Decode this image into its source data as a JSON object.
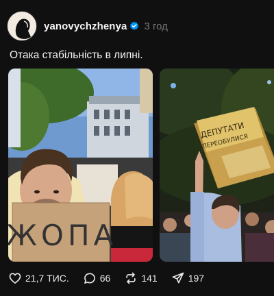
{
  "post": {
    "author": {
      "username": "yanovychzhenya",
      "verified": true,
      "avatar_icon": "silhouette-avatar-icon"
    },
    "time_ago": "3 год",
    "text": "Отака стабільність в липні."
  },
  "photos": [
    {
      "sign_text": "ЖОПА"
    },
    {
      "sign_text_line1": "ДЕПУТАТИ",
      "sign_text_line2": "ПЕРЕОБУЛИСЯ"
    }
  ],
  "actions": {
    "likes": "21,7 ТИС.",
    "comments": "66",
    "reposts": "141",
    "shares": "197"
  },
  "colors": {
    "background": "#101010",
    "text": "#f3f5f7",
    "muted": "#777777",
    "verified": "#0095f6"
  }
}
